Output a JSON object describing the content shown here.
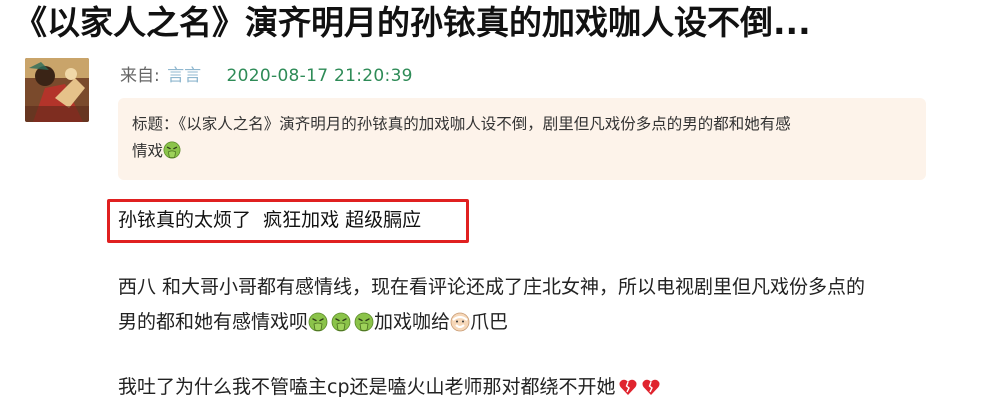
{
  "post": {
    "title": "《以家人之名》演齐明月的孙铱真的加戏咖人设不倒...",
    "from_label": "来自:",
    "author": "言言",
    "timestamp": "2020-08-17 21:20:39"
  },
  "quote": {
    "line1": "标题：《以家人之名》演齐明月的孙铱真的加戏咖人设不倒，剧里但凡戏份多点的男的都和她有感",
    "line2": "情戏"
  },
  "highlighted_text": "孙铱真的太烦了  疯狂加戏 超级膈应",
  "paragraph1": {
    "line1": "西八 和大哥小哥都有感情线，现在看评论还成了庄北女神，所以电视剧里但凡戏份多点的",
    "line2_start": "男的都和她有感情戏呗",
    "line2_mid": "加戏咖给",
    "line2_end": "爪巴"
  },
  "paragraph2": {
    "text": "我吐了为什么我不管嗑主cp还是嗑火山老师那对都绕不开她"
  },
  "icons": {
    "vomit": "vomiting-face-icon",
    "grandpa": "old-man-face-icon",
    "broken_heart": "broken-heart-icon"
  },
  "colors": {
    "timestamp": "#2e8b57",
    "author": "#8fb7cf",
    "quote_bg": "#fdf3ea",
    "highlight_border": "#e02020"
  }
}
